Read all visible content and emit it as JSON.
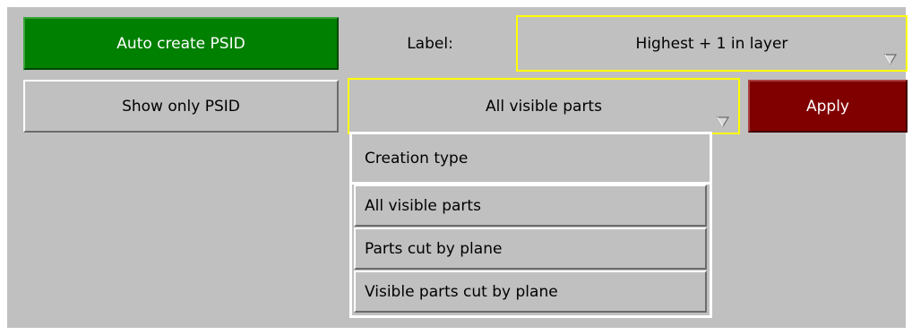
{
  "toolbar": {
    "auto_create_label": "Auto create PSID",
    "label_caption": "Label:",
    "label_dropdown_value": "Highest + 1 in layer",
    "show_only_label": "Show only PSID",
    "type_dropdown_value": "All visible parts",
    "apply_label": "Apply"
  },
  "menu": {
    "title": "Creation type",
    "items": [
      {
        "label": "All visible parts"
      },
      {
        "label": "Parts cut by plane"
      },
      {
        "label": "Visible parts cut by plane"
      }
    ]
  },
  "colors": {
    "panel_bg": "#c0c0c0",
    "auto_create_bg": "#008000",
    "apply_bg": "#800000",
    "dropdown_highlight": "#ffff00"
  },
  "icons": {
    "dropdown_caret": "chevron-down-icon"
  }
}
